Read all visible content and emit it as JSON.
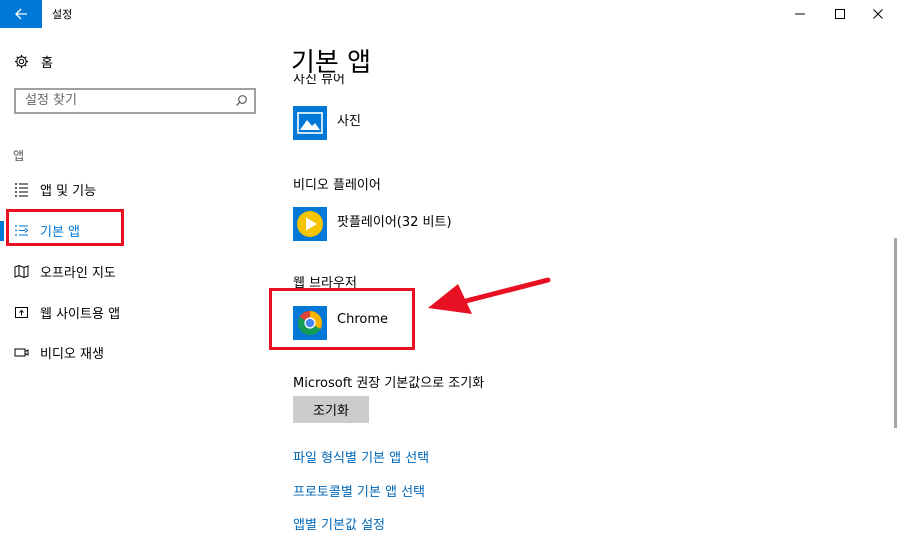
{
  "window": {
    "title": "설정"
  },
  "sidebar": {
    "home_label": "홈",
    "search_placeholder": "설정 찾기",
    "section_label": "앱",
    "items": [
      {
        "label": "앱 및 기능",
        "icon": "list-icon"
      },
      {
        "label": "기본 앱",
        "icon": "default-apps-icon",
        "selected": true
      },
      {
        "label": "오프라인 지도",
        "icon": "map-icon"
      },
      {
        "label": "웹 사이트용 앱",
        "icon": "website-app-icon"
      },
      {
        "label": "비디오 재생",
        "icon": "video-icon"
      }
    ]
  },
  "main": {
    "title": "기본 앱",
    "photo_viewer": {
      "header": "사진 뷰어",
      "app": "사진"
    },
    "video_player": {
      "header": "비디오 플레이어",
      "app": "팟플레이어(32 비트)"
    },
    "web_browser": {
      "header": "웹 브라우저",
      "app": "Chrome"
    },
    "reset": {
      "label": "Microsoft 권장 기본값으로 조기화",
      "button": "조기화"
    },
    "links": [
      "파일 형식별 기본 앱 선택",
      "프로토콜별 기본 앱 선택",
      "앱별 기본값 설정"
    ]
  },
  "colors": {
    "accent": "#0078d7",
    "link": "#0067b8",
    "annotation": "#e81123"
  }
}
